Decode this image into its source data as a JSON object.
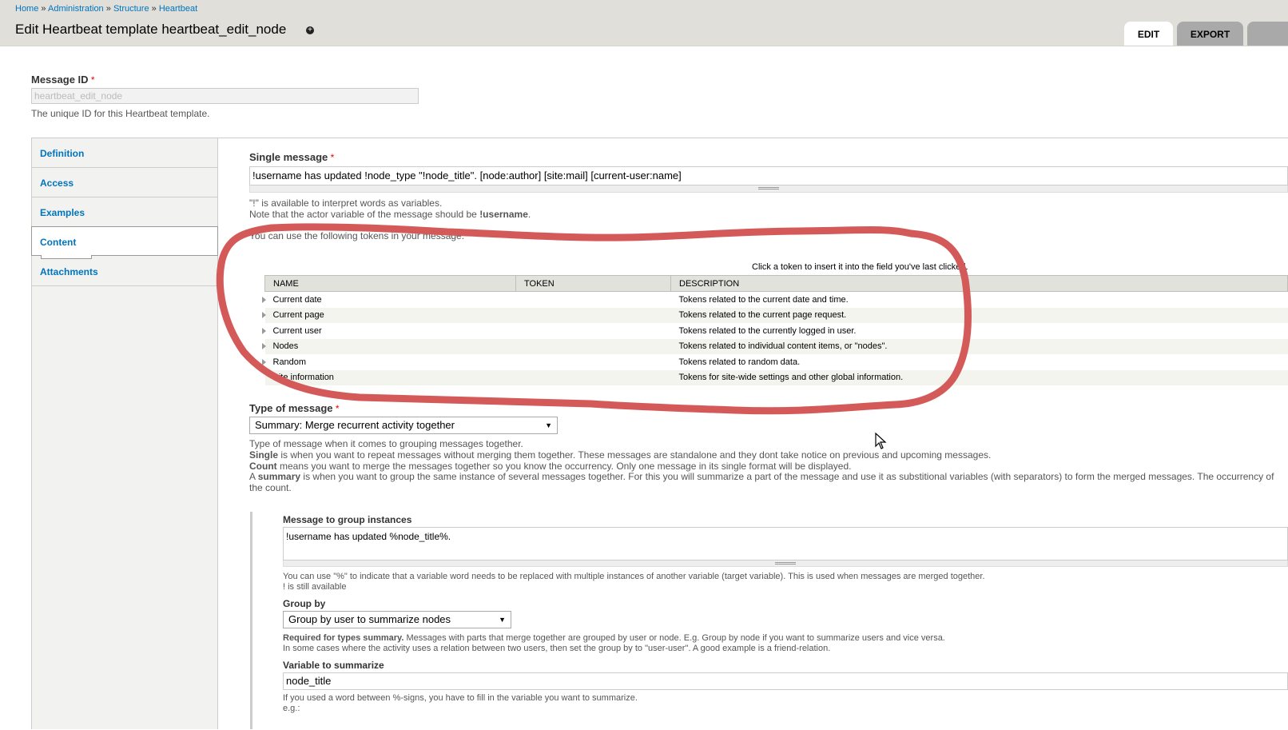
{
  "breadcrumb": {
    "items": [
      "Home",
      "Administration",
      "Structure",
      "Heartbeat"
    ],
    "separator": "»"
  },
  "page_title": "Edit Heartbeat template heartbeat_edit_node",
  "tabs": {
    "edit": "EDIT",
    "export": "EXPORT"
  },
  "message_id": {
    "label": "Message ID",
    "required": "*",
    "value": "heartbeat_edit_node",
    "description": "The unique ID for this Heartbeat template."
  },
  "vertical_tabs": [
    "Definition",
    "Access",
    "Examples",
    "Content",
    "Attachments"
  ],
  "single_message": {
    "label": "Single message",
    "required": "*",
    "value": "!username has updated !node_type \"!node_title\". [node:author] [site:mail] [current-user:name]",
    "help1": "\"!\" is available to interpret words as variables.",
    "help2_prefix": "Note that the actor variable of the message should be ",
    "help2_bold": "!username",
    "help2_suffix": ".",
    "tokens_intro": "You can use the following tokens in your message:",
    "tokens_hint": "Click a token to insert it into the field you've last clicked."
  },
  "token_table": {
    "headers": [
      "NAME",
      "TOKEN",
      "DESCRIPTION"
    ],
    "rows": [
      {
        "name": "Current date",
        "token": "",
        "description": "Tokens related to the current date and time."
      },
      {
        "name": "Current page",
        "token": "",
        "description": "Tokens related to the current page request."
      },
      {
        "name": "Current user",
        "token": "",
        "description": "Tokens related to the currently logged in user."
      },
      {
        "name": "Nodes",
        "token": "",
        "description": "Tokens related to individual content items, or \"nodes\"."
      },
      {
        "name": "Random",
        "token": "",
        "description": "Tokens related to random data."
      },
      {
        "name": "Site information",
        "token": "",
        "description": "Tokens for site-wide settings and other global information."
      }
    ]
  },
  "type_of_message": {
    "label": "Type of message",
    "required": "*",
    "selected": "Summary: Merge recurrent activity together",
    "desc1": "Type of message when it comes to grouping messages together.",
    "desc2_bold": "Single",
    "desc2": " is when you want to repeat messages without merging them together. These messages are standalone and they dont take notice on previous and upcoming messages.",
    "desc3_bold": "Count",
    "desc3": " means you want to merge the messages together so you know the occurrency. Only one message in its single format will be displayed.",
    "desc4_prefix": "A ",
    "desc4_bold": "summary",
    "desc4": " is when you want to group the same instance of several messages together. For this you will summarize a part of the message and use it as substitional variables (with separators) to form the merged messages. The occurrency of",
    "desc5": "the count."
  },
  "group_instances": {
    "label": "Message to group instances",
    "value": "!username has updated %node_title%.",
    "help1": "You can use \"%\" to indicate that a variable word needs to be replaced with multiple instances of another variable (target variable). This is used when messages are merged together.",
    "help2": "! is still available"
  },
  "group_by": {
    "label": "Group by",
    "selected": "Group by user to summarize nodes",
    "help1_bold": "Required for types summary.",
    "help1": " Messages with parts that merge together are grouped by user or node. E.g. Group by node if you want to summarize users and vice versa.",
    "help2": "In some cases where the activity uses a relation between two users, then set the group by to \"user-user\". A good example is a friend-relation."
  },
  "variable_to_summarize": {
    "label": "Variable to summarize",
    "value": "node_title",
    "help1": "If you used a word between %-signs, you have to fill in the variable you want to summarize.",
    "help2": "e.g.:"
  },
  "colors": {
    "link": "#0074bd",
    "annotation": "#d45a5a",
    "header_bg": "#e0dfd9",
    "required": "#ee0000"
  },
  "icons": {
    "shortcut": "add-shortcut-icon",
    "cursor": "mouse-pointer-icon",
    "select_arrow": "dropdown-arrow-icon"
  }
}
